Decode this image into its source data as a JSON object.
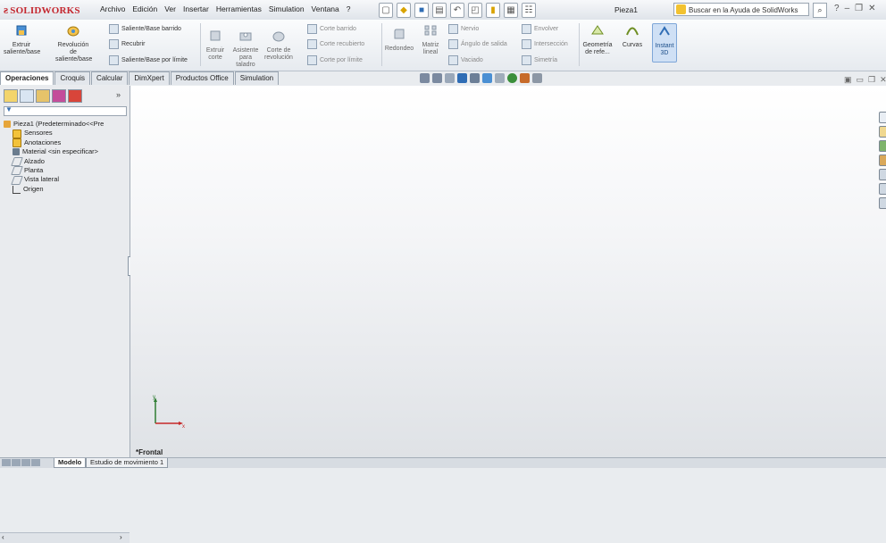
{
  "app": {
    "logo": "SOLIDWORKS",
    "document_title": "Pieza1"
  },
  "menu": [
    "Archivo",
    "Edición",
    "Ver",
    "Insertar",
    "Herramientas",
    "Simulation",
    "Ventana",
    "?"
  ],
  "search": {
    "placeholder": "Buscar en la Ayuda de SolidWorks"
  },
  "ribbon": {
    "extruir_saliente": "Extruir saliente/base",
    "revolucion_saliente": "Revolución de saliente/base",
    "saliente_barrido": "Saliente/Base barrido",
    "recubrir": "Recubrir",
    "saliente_limite": "Saliente/Base por límite",
    "extruir_corte": "Extruir corte",
    "asistente_taladro": "Asistente para taladro",
    "corte_revolucion": "Corte de revolución",
    "corte_barrido": "Corte barrido",
    "corte_recubierto": "Corte recubierto",
    "corte_limite": "Corte por límite",
    "redondeo": "Redondeo",
    "matriz_lineal": "Matriz lineal",
    "nervio": "Nervio",
    "angulo_salida": "Ángulo de salida",
    "vaciado": "Vaciado",
    "envolver": "Envolver",
    "interseccion": "Intersección",
    "simetria": "Simetría",
    "geometria": "Geometría de refe...",
    "curvas": "Curvas",
    "instant3d": "Instant 3D"
  },
  "tabs": [
    "Operaciones",
    "Croquis",
    "Calcular",
    "DimXpert",
    "Productos Office",
    "Simulation"
  ],
  "tree": {
    "root": "Pieza1 (Predeterminado<<Pre",
    "items": [
      "Sensores",
      "Anotaciones",
      "Material <sin especificar>",
      "Alzado",
      "Planta",
      "Vista lateral",
      "Origen"
    ]
  },
  "viewport": {
    "view_name": "*Frontal",
    "triad_x": "x",
    "triad_y": "y"
  },
  "bottom_tabs": [
    "Modelo",
    "Estudio de movimiento 1"
  ],
  "colors": {
    "brand": "#c4262e",
    "accent": "#2f6db5",
    "viewport_bg": "#e6e8eb"
  }
}
